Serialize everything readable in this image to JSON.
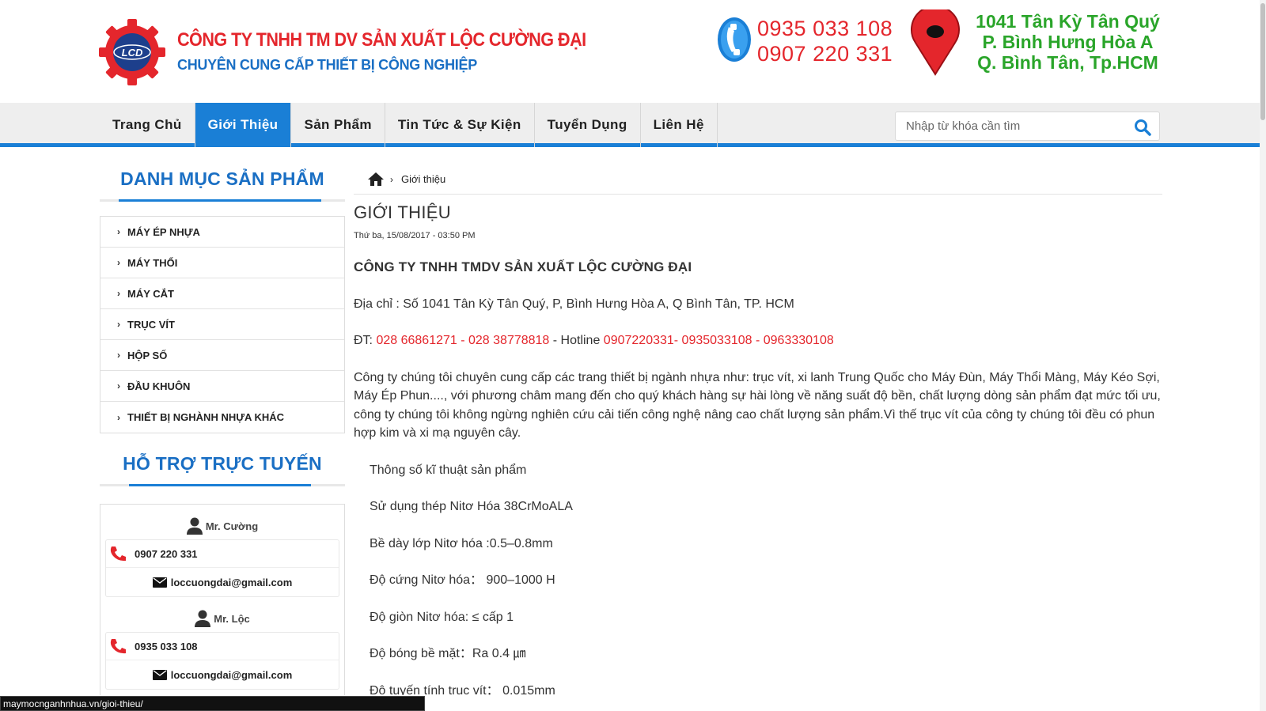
{
  "header": {
    "logo_text": "LCD",
    "company_name": "CÔNG TY TNHH TM DV SẢN XUẤT LỘC CƯỜNG ĐẠI",
    "tagline": "CHUYÊN CUNG CẤP THIẾT BỊ CÔNG NGHIỆP",
    "phone_1": "0935 033 108",
    "phone_2": "0907 220 331",
    "address_1": "1041 Tân Kỳ Tân Quý",
    "address_2": "P. Bình Hưng Hòa A",
    "address_3": "Q. Bình Tân, Tp.HCM",
    "brand_red": "#e4262c",
    "brand_blue": "#1a6fc4",
    "address_green": "#2aa52a"
  },
  "nav": {
    "items": [
      {
        "label": "Trang Chủ"
      },
      {
        "label": "Giới Thiệu"
      },
      {
        "label": "Sản Phẩm"
      },
      {
        "label": "Tin Tức & Sự Kiện"
      },
      {
        "label": "Tuyển Dụng"
      },
      {
        "label": "Liên Hệ"
      }
    ],
    "active_index": 1,
    "search_placeholder": "Nhập từ khóa cần tìm",
    "accent": "#1a7fd6"
  },
  "sidebar": {
    "categories_title": "DANH MỤC SẢN PHẨM",
    "categories": [
      {
        "label": "MÁY ÉP NHỰA"
      },
      {
        "label": "MÁY THỔI"
      },
      {
        "label": "MÁY CẮT"
      },
      {
        "label": "TRỤC VÍT"
      },
      {
        "label": "HỘP SỐ"
      },
      {
        "label": "ĐẦU KHUÔN"
      },
      {
        "label": "THIẾT BỊ NGHÀNH NHỰA KHÁC"
      }
    ],
    "support_title": "HỖ TRỢ TRỰC TUYẾN",
    "contacts": [
      {
        "name": "Mr. Cường",
        "phone": "0907 220 331",
        "email": "loccuongdai@gmail.com"
      },
      {
        "name": "Mr. Lộc",
        "phone": "0935 033 108",
        "email": "loccuongdai@gmail.com"
      }
    ]
  },
  "content": {
    "breadcrumb_current": "Giới thiệu",
    "title": "GIỚI THIỆU",
    "date": "Thứ ba, 15/08/2017 - 03:50 PM",
    "company": "CÔNG TY TNHH TMDV SẢN XUẤT LỘC CƯỜNG ĐẠI",
    "address": "Địa chỉ : Số 1041 Tân Kỳ Tân Quý, P, Bình Hưng Hòa A, Q Bình Tân, TP. HCM",
    "phone_label": "ĐT: ",
    "phone_numbers": "028 66861271 - 028 38778818",
    "hotline_label": " - Hotline ",
    "hotline_numbers": "0907220331- 0935033108 - 0963330108",
    "intro": "Công ty chúng tôi chuyên cung cấp các trang thiết bị ngành nhựa như: trục vít, xi lanh Trung Quốc cho Máy Đùn, Máy Thổi Màng, Máy Kéo Sợi, Máy Ép Phun...., với phương châm mang đến cho quý khách hàng sự hài lòng về năng suất độ bền, chất lượng dòng sản phẩm đạt mức tối ưu, công ty chúng tôi không ngừng nghiên cứu cải tiến công nghệ nâng cao chất lượng sản phẩm.Vì thế trục vít của công ty chúng tôi đều có phun hợp kim và xi mạ nguyên cây.",
    "specs": [
      "Thông số kĩ thuật sản phẩm",
      "Sử  dụng thép Nitơ Hóa 38CrMoALA",
      "Bề dày lớp Nitơ hóa :0.5–0.8mm",
      "Độ  cứng Nitơ hóa： 900–1000 H",
      "Độ giòn Nitơ hóa: ≤ cấp 1",
      "Độ bóng bề mặt：Ra 0.4 ㎛",
      "Độ tuyến tính trục vít： 0.015mm"
    ]
  },
  "status_bar": {
    "url": "maymocnganhnhua.vn/gioi-thieu/"
  }
}
